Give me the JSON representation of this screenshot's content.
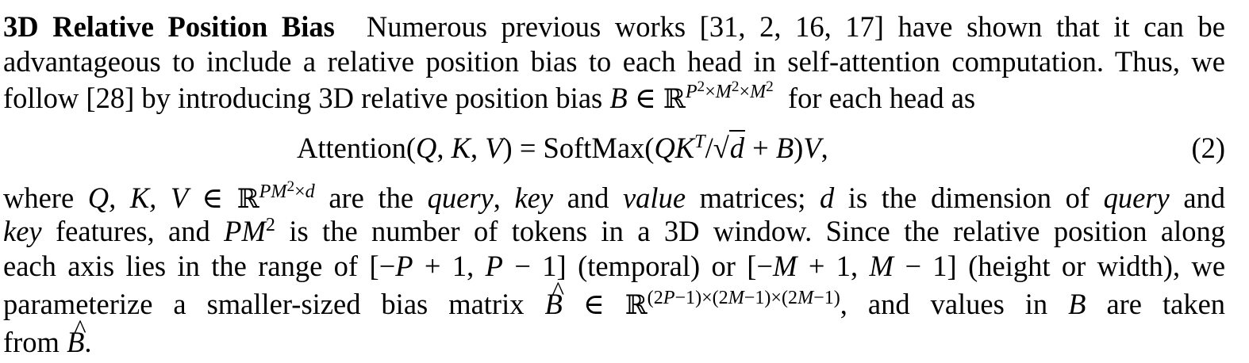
{
  "paragraph": {
    "heading": "3D Relative Position Bias",
    "line1": "Numerous previous works [31, 2, 16, 17] have shown that it can be",
    "line2": "advantageous to include a relative position bias to each head in self-attention computation. Thus, we",
    "line3_a": "follow [28] by introducing 3D relative position bias",
    "line3_b": "for each head as",
    "equation_label": "Attention",
    "equation_softmax": "SoftMax",
    "equation_number": "(2)",
    "line5_a": "where",
    "line5_b": "are the",
    "line5_query": "query",
    "line5_key": "key",
    "line5_and": "and",
    "line5_value": "value",
    "line5_c": "matrices;",
    "line5_d": "is the dimension of",
    "line5_query2": "query",
    "line5_and2": "and",
    "line6_key": "key",
    "line6_a": "features, and",
    "line6_b": "is the number of tokens in a 3D window. Since the relative position along",
    "line7_a": "each axis lies in the range of",
    "line7_b": "(temporal) or",
    "line7_c": "(height or width), we",
    "line8_a": "parameterize a smaller-sized bias matrix",
    "line8_b": ", and values in",
    "line8_c": "are taken",
    "line9_a": "from",
    "line9_b": "."
  }
}
